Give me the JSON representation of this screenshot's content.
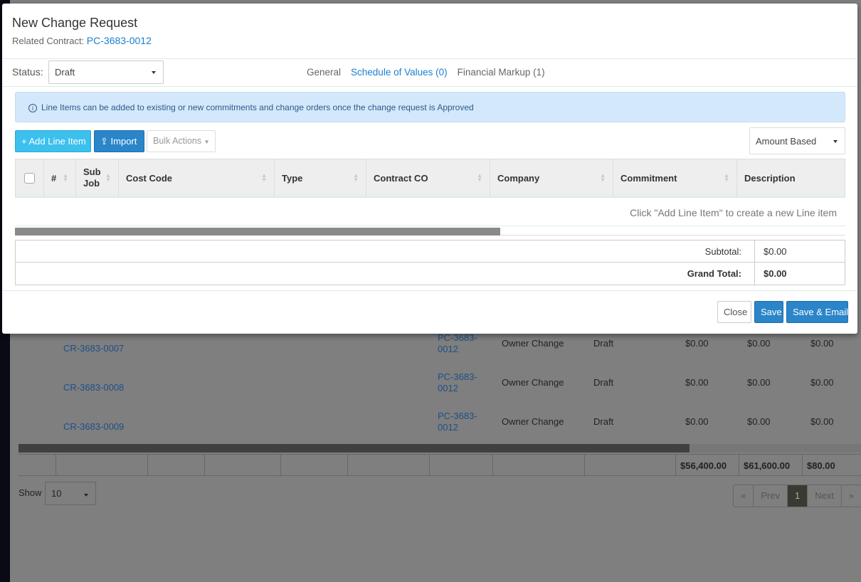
{
  "modal": {
    "title": "New Change Request",
    "related_label": "Related Contract:",
    "related_value": "PC-3683-0012",
    "status_label": "Status:",
    "status_value": "Draft",
    "tabs": [
      {
        "label": "General"
      },
      {
        "label": "Schedule of Values (0)"
      },
      {
        "label": "Financial Markup (1)"
      }
    ],
    "alert": "Line Items can be added to existing or new commitments and change orders once the change request is Approved",
    "add_line_item": "Add Line Item",
    "import": "Import",
    "bulk_actions": "Bulk Actions",
    "amount_mode": "Amount Based",
    "columns": [
      "#",
      "Sub Job",
      "Cost Code",
      "Type",
      "Contract CO",
      "Company",
      "Commitment",
      "Description"
    ],
    "empty_message": "Click \"Add Line Item\" to create a new Line item",
    "subtotal_label": "Subtotal:",
    "subtotal_value": "$0.00",
    "grand_total_label": "Grand Total:",
    "grand_total_value": "$0.00",
    "close": "Close",
    "save": "Save",
    "save_email": "Save & Email"
  },
  "background": {
    "rows": [
      {
        "id": "CR-3683-0007",
        "contract1": "PC-3683-",
        "contract2": "0012",
        "type": "Owner Change",
        "status": "Draft",
        "a": "$0.00",
        "b": "$0.00",
        "c": "$0.00"
      },
      {
        "id": "CR-3683-0008",
        "contract1": "PC-3683-",
        "contract2": "0012",
        "type": "Owner Change",
        "status": "Draft",
        "a": "$0.00",
        "b": "$0.00",
        "c": "$0.00"
      },
      {
        "id": "CR-3683-0009",
        "contract1": "PC-3683-",
        "contract2": "0012",
        "type": "Owner Change",
        "status": "Draft",
        "a": "$0.00",
        "b": "$0.00",
        "c": "$0.00"
      }
    ],
    "totals": [
      "$56,400.00",
      "$61,600.00",
      "$80.00"
    ],
    "show_label": "Show",
    "show_value": "10",
    "pager": {
      "first": "«",
      "prev": "Prev",
      "page": "1",
      "next": "Next",
      "last": "»"
    }
  }
}
